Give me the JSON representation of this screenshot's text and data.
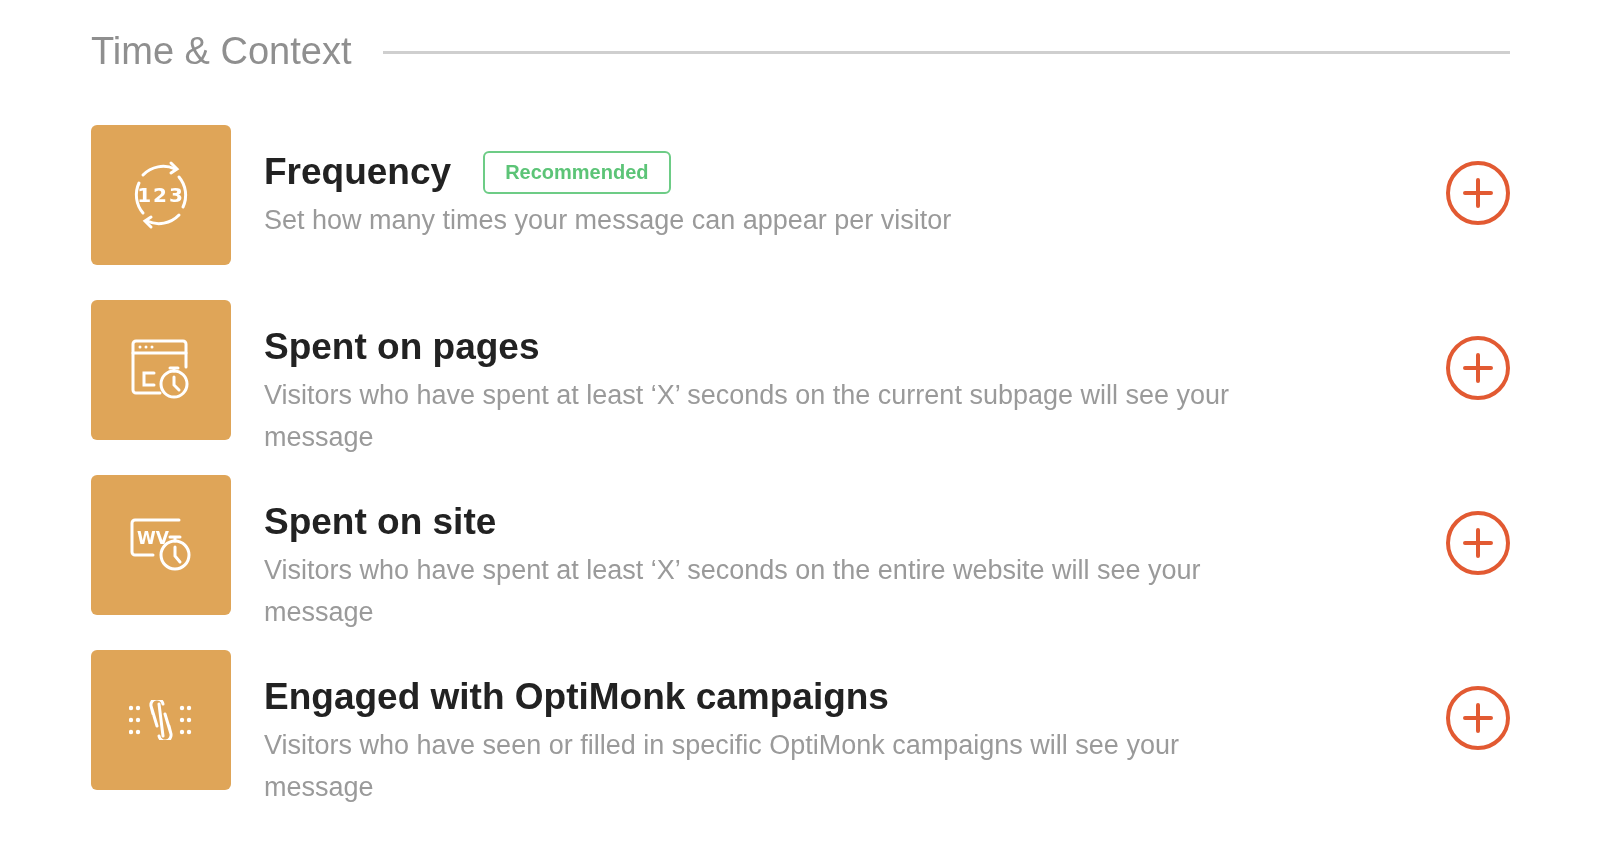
{
  "section": {
    "title": "Time & Context"
  },
  "items": [
    {
      "kind": "counter",
      "icon_text": "123",
      "title": "Frequency",
      "badge": "Recommended",
      "description": "Set how many times your message can appear per visitor"
    },
    {
      "kind": "page-timer",
      "title": "Spent on pages",
      "description": "Visitors who have spent at least ‘X’ seconds on the current subpage will see your message"
    },
    {
      "kind": "site-timer",
      "icon_text": "WV",
      "title": "Spent on site",
      "description": "Visitors who have spent at least ‘X’ seconds on the entire website will see your message"
    },
    {
      "kind": "link",
      "title": "Engaged with OptiMonk campaigns",
      "description": "Visitors who have seen or filled in specific OptiMonk campaigns will see your message"
    }
  ]
}
